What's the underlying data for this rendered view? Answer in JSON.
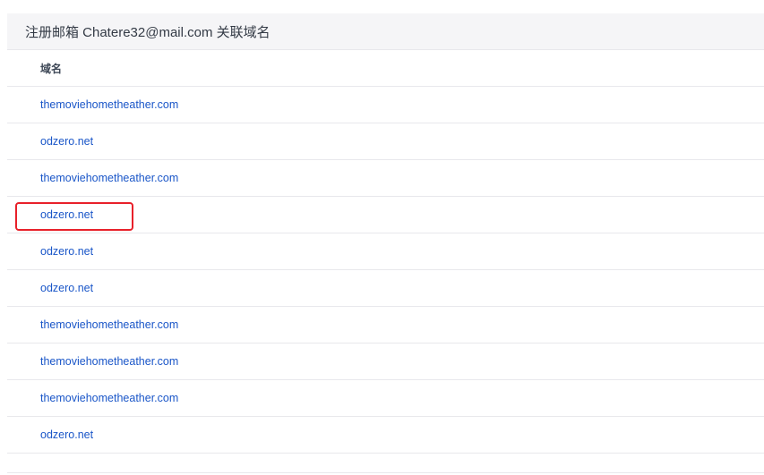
{
  "panel": {
    "title": "注册邮箱 Chatere32@mail.com 关联域名"
  },
  "table": {
    "column_header": "域名",
    "rows": [
      {
        "domain": "themoviehometheather.com",
        "highlighted": false
      },
      {
        "domain": "odzero.net",
        "highlighted": false
      },
      {
        "domain": "themoviehometheather.com",
        "highlighted": false
      },
      {
        "domain": "odzero.net",
        "highlighted": true
      },
      {
        "domain": "odzero.net",
        "highlighted": false
      },
      {
        "domain": "odzero.net",
        "highlighted": false
      },
      {
        "domain": "themoviehometheather.com",
        "highlighted": false
      },
      {
        "domain": "themoviehometheather.com",
        "highlighted": false
      },
      {
        "domain": "themoviehometheather.com",
        "highlighted": false
      },
      {
        "domain": "odzero.net",
        "highlighted": false
      }
    ]
  },
  "colors": {
    "link": "#1a56c8",
    "highlight_box": "#e8202a",
    "header_bg": "#f5f5f7"
  }
}
